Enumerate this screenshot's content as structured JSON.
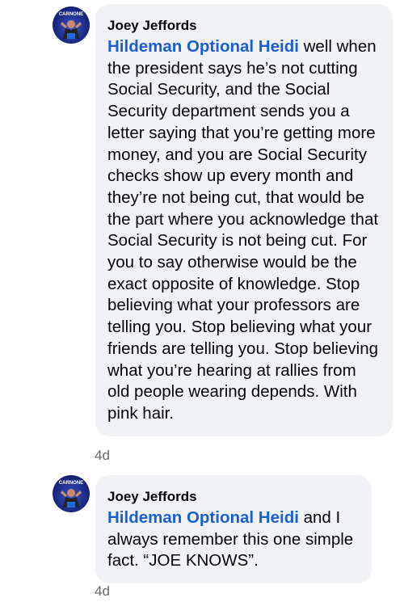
{
  "comments": [
    {
      "author": "Joey Jeffords",
      "avatar_icon": "profile-photo-icon",
      "avatar_text": "CARNONE",
      "mention": "Hildeman Optional Heidi",
      "text": " well when the president says he’s not cutting Social Security, and the Social Security department sends you a letter saying that you’re getting more money, and you are Social Security checks show up every month and they’re not being cut, that would be the part where you acknowledge that Social Security is not being cut.  For you to say otherwise would be the exact opposite of knowledge. Stop believing what your professors are telling you. Stop believing what your friends are telling you. Stop believing what you’re hearing at rallies from old people wearing depends. With pink hair.",
      "time": "4d"
    },
    {
      "author": "Joey Jeffords",
      "avatar_icon": "profile-photo-icon",
      "avatar_text": "CARNONE",
      "mention": "Hildeman Optional Heidi",
      "text": " and I always remember this one simple fact. “JOE KNOWS”.",
      "time": "4d"
    }
  ],
  "colors": {
    "bubble": "#f0f2f5",
    "mention": "#1a5fd1",
    "text": "#050505",
    "meta": "#65676b"
  }
}
